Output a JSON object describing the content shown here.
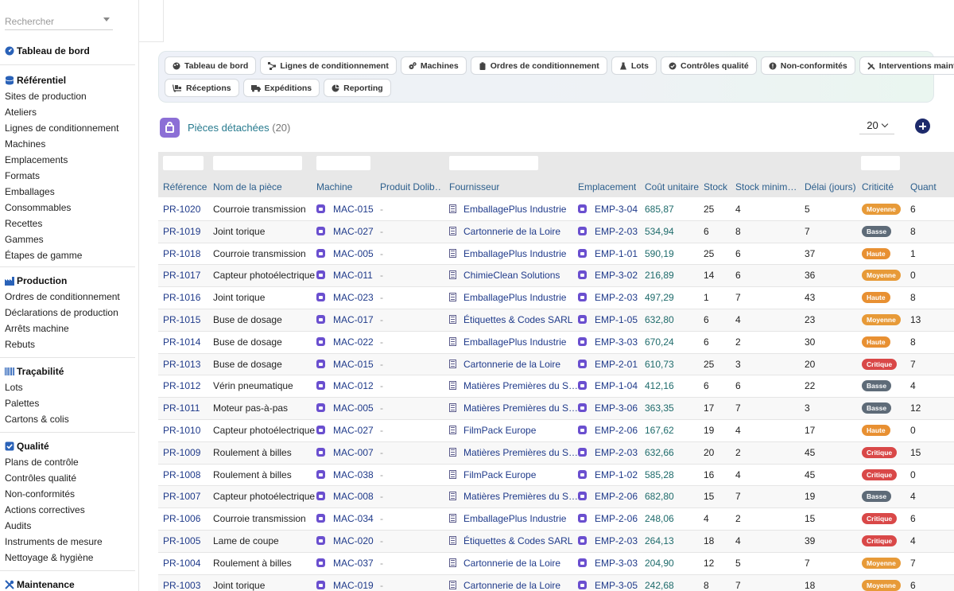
{
  "search": {
    "placeholder": "Rechercher"
  },
  "sidebar": {
    "dashboard": "Tableau de bord",
    "sections": [
      {
        "title": "Référentiel",
        "icon": "database-icon",
        "items": [
          "Sites de production",
          "Ateliers",
          "Lignes de conditionnement",
          "Machines",
          "Emplacements",
          "Formats",
          "Emballages",
          "Consommables",
          "Recettes",
          "Gammes",
          "Étapes de gamme"
        ]
      },
      {
        "title": "Production",
        "icon": "factory-icon",
        "items": [
          "Ordres de conditionnement",
          "Déclarations de production",
          "Arrêts machine",
          "Rebuts"
        ]
      },
      {
        "title": "Traçabilité",
        "icon": "barcode-icon",
        "items": [
          "Lots",
          "Palettes",
          "Cartons & colis"
        ]
      },
      {
        "title": "Qualité",
        "icon": "check-square-icon",
        "items": [
          "Plans de contrôle",
          "Contrôles qualité",
          "Non-conformités",
          "Actions correctives",
          "Audits",
          "Instruments de mesure",
          "Nettoyage & hygiène"
        ]
      },
      {
        "title": "Maintenance",
        "icon": "tools-icon",
        "items": []
      }
    ]
  },
  "menu": {
    "row1": [
      {
        "label": "Tableau de bord",
        "icon": "palette-icon"
      },
      {
        "label": "Lignes de conditionnement",
        "icon": "network-icon"
      },
      {
        "label": "Machines",
        "icon": "cogs-icon"
      },
      {
        "label": "Ordres de conditionnement",
        "icon": "clipboard-icon"
      },
      {
        "label": "Lots",
        "icon": "flask-icon"
      },
      {
        "label": "Contrôles qualité",
        "icon": "check-circle-icon"
      },
      {
        "label": "Non-conformités",
        "icon": "exclamation-circle-icon"
      },
      {
        "label": "Interventions maintenance",
        "icon": "tools-icon"
      }
    ],
    "row2": [
      {
        "label": "Réceptions",
        "icon": "dolly-icon"
      },
      {
        "label": "Expéditions",
        "icon": "truck-icon"
      },
      {
        "label": "Reporting",
        "icon": "chart-pie-icon"
      }
    ]
  },
  "page": {
    "title": "Pièces détachées",
    "count": "(20)",
    "per_page": "20"
  },
  "table": {
    "columns": [
      "Référence",
      "Nom de la pièce",
      "Machine",
      "Produit Dolib…",
      "Fournisseur",
      "Emplacement",
      "Coût unitaire",
      "Stock",
      "Stock minim…",
      "Délai (jours)",
      "Criticité",
      "Quant"
    ],
    "rows": [
      [
        "PR-1020",
        "Courroie transmission",
        "MAC-015",
        "-",
        "EmballagePlus Industrie",
        "EMP-3-04",
        "685,87",
        "25",
        "4",
        "5",
        "Moyenne",
        "6"
      ],
      [
        "PR-1019",
        "Joint torique",
        "MAC-027",
        "-",
        "Cartonnerie de la Loire",
        "EMP-2-03",
        "534,94",
        "6",
        "8",
        "7",
        "Basse",
        "8"
      ],
      [
        "PR-1018",
        "Courroie transmission",
        "MAC-005",
        "-",
        "EmballagePlus Industrie",
        "EMP-1-01",
        "590,19",
        "25",
        "6",
        "37",
        "Haute",
        "1"
      ],
      [
        "PR-1017",
        "Capteur photoélectrique",
        "MAC-011",
        "-",
        "ChimieClean Solutions",
        "EMP-3-02",
        "216,89",
        "14",
        "6",
        "36",
        "Moyenne",
        "0"
      ],
      [
        "PR-1016",
        "Joint torique",
        "MAC-023",
        "-",
        "EmballagePlus Industrie",
        "EMP-2-03",
        "497,29",
        "1",
        "7",
        "43",
        "Haute",
        "8"
      ],
      [
        "PR-1015",
        "Buse de dosage",
        "MAC-017",
        "-",
        "Étiquettes & Codes SARL",
        "EMP-1-05",
        "632,80",
        "6",
        "4",
        "23",
        "Moyenne",
        "13"
      ],
      [
        "PR-1014",
        "Buse de dosage",
        "MAC-022",
        "-",
        "EmballagePlus Industrie",
        "EMP-3-03",
        "670,24",
        "6",
        "2",
        "30",
        "Haute",
        "8"
      ],
      [
        "PR-1013",
        "Buse de dosage",
        "MAC-015",
        "-",
        "Cartonnerie de la Loire",
        "EMP-2-01",
        "610,73",
        "25",
        "3",
        "20",
        "Critique",
        "7"
      ],
      [
        "PR-1012",
        "Vérin pneumatique",
        "MAC-012",
        "-",
        "Matières Premières du S…",
        "EMP-1-04",
        "412,16",
        "6",
        "6",
        "22",
        "Basse",
        "4"
      ],
      [
        "PR-1011",
        "Moteur pas-à-pas",
        "MAC-005",
        "-",
        "Matières Premières du S…",
        "EMP-3-06",
        "363,35",
        "17",
        "7",
        "3",
        "Basse",
        "12"
      ],
      [
        "PR-1010",
        "Capteur photoélectrique",
        "MAC-027",
        "-",
        "FilmPack Europe",
        "EMP-2-06",
        "167,62",
        "19",
        "4",
        "17",
        "Haute",
        "0"
      ],
      [
        "PR-1009",
        "Roulement à billes",
        "MAC-007",
        "-",
        "Matières Premières du S…",
        "EMP-2-03",
        "632,66",
        "20",
        "2",
        "45",
        "Critique",
        "15"
      ],
      [
        "PR-1008",
        "Roulement à billes",
        "MAC-038",
        "-",
        "FilmPack Europe",
        "EMP-1-02",
        "585,28",
        "16",
        "4",
        "45",
        "Critique",
        "0"
      ],
      [
        "PR-1007",
        "Capteur photoélectrique",
        "MAC-008",
        "-",
        "Matières Premières du S…",
        "EMP-2-06",
        "682,80",
        "15",
        "7",
        "19",
        "Basse",
        "4"
      ],
      [
        "PR-1006",
        "Courroie transmission",
        "MAC-034",
        "-",
        "EmballagePlus Industrie",
        "EMP-2-06",
        "248,06",
        "4",
        "2",
        "15",
        "Critique",
        "6"
      ],
      [
        "PR-1005",
        "Lame de coupe",
        "MAC-020",
        "-",
        "Étiquettes & Codes SARL",
        "EMP-2-03",
        "264,13",
        "18",
        "4",
        "39",
        "Critique",
        "4"
      ],
      [
        "PR-1004",
        "Roulement à billes",
        "MAC-037",
        "-",
        "Cartonnerie de la Loire",
        "EMP-3-03",
        "204,90",
        "12",
        "5",
        "7",
        "Moyenne",
        "7"
      ],
      [
        "PR-1003",
        "Joint torique",
        "MAC-019",
        "-",
        "Cartonnerie de la Loire",
        "EMP-3-05",
        "242,68",
        "8",
        "7",
        "18",
        "Moyenne",
        "6"
      ]
    ]
  },
  "colors": {
    "accent": "#1f3a8a",
    "title": "#267a8e",
    "moyenne": "#e79a38",
    "basse": "#5e6b78",
    "haute": "#e89032",
    "critique": "#d94848"
  }
}
